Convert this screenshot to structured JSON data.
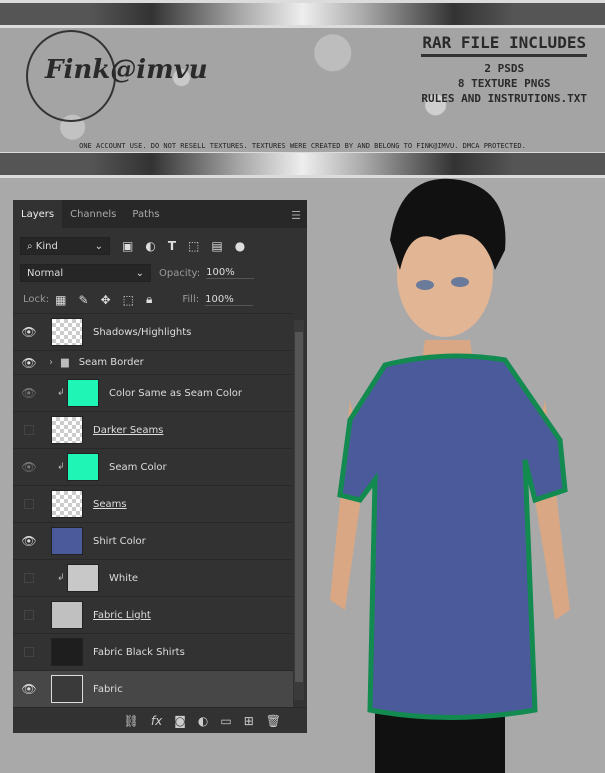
{
  "banner": {
    "logo": "Fink@imvu",
    "title": "RAR FILE INCLUDES",
    "items": [
      "2 PSDS",
      "8 TEXTURE PNGS",
      "RULES AND INSTRUTIONS.TXT"
    ],
    "notice": "ONE ACCOUNT USE. DO NOT RESELL TEXTURES. TEXTURES WERE CREATED BY AND BELONG TO FINK@IMVU. DMCA PROTECTED."
  },
  "panel": {
    "tabs": [
      "Layers",
      "Channels",
      "Paths"
    ],
    "filter": "Kind",
    "blend": "Normal",
    "opacity_label": "Opacity:",
    "opacity": "100%",
    "lock_label": "Lock:",
    "fill_label": "Fill:",
    "fill": "100%",
    "layers": [
      {
        "name": "Shadows/Highlights",
        "visible": true
      },
      {
        "name": "Seam Border",
        "visible": true
      },
      {
        "name": "Color Same as Seam Color",
        "visible": "dim"
      },
      {
        "name": "Darker Seams",
        "visible": false
      },
      {
        "name": "Seam Color",
        "visible": "dim"
      },
      {
        "name": "Seams",
        "visible": false
      },
      {
        "name": "Shirt Color",
        "visible": true
      },
      {
        "name": "White",
        "visible": false
      },
      {
        "name": "Fabric Light",
        "visible": false
      },
      {
        "name": "Fabric Black Shirts",
        "visible": false
      },
      {
        "name": "Fabric",
        "visible": true
      }
    ]
  },
  "colors": {
    "seam": "#1ff5b5",
    "shirt": "#4a5a9a",
    "white": "#c8c8c8",
    "black": "#1e1e1e"
  }
}
